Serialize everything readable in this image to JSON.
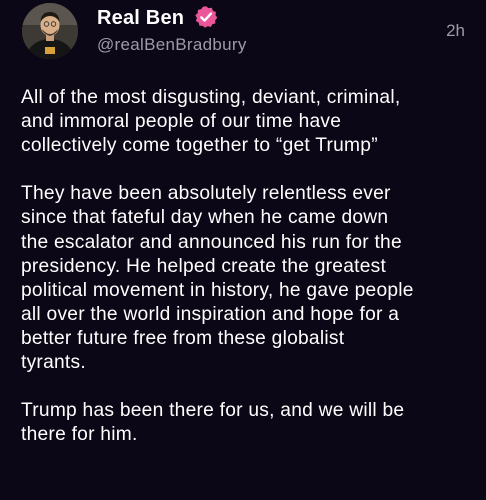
{
  "post": {
    "author": {
      "display_name": "Real Ben",
      "handle": "@realBenBradbury",
      "verified": true,
      "verified_color": "#e9579a",
      "avatar_icon": "user-avatar"
    },
    "timestamp": "2h",
    "paragraphs": [
      "All of the most disgusting, deviant, criminal,\nand immoral people of our time have\ncollectively come together to “get Trump”",
      "They have been absolutely relentless ever\nsince that fateful day when he came down\nthe escalator and announced his run for the\npresidency. He helped create the greatest\npolitical movement in history, he gave people\nall over the world inspiration and hope for a\nbetter future free from these globalist\ntyrants.",
      "Trump has been there for us, and we will be\nthere for him."
    ]
  },
  "colors": {
    "background": "#0c0716",
    "text_primary": "#ffffff",
    "text_secondary": "#9e9aa7"
  }
}
